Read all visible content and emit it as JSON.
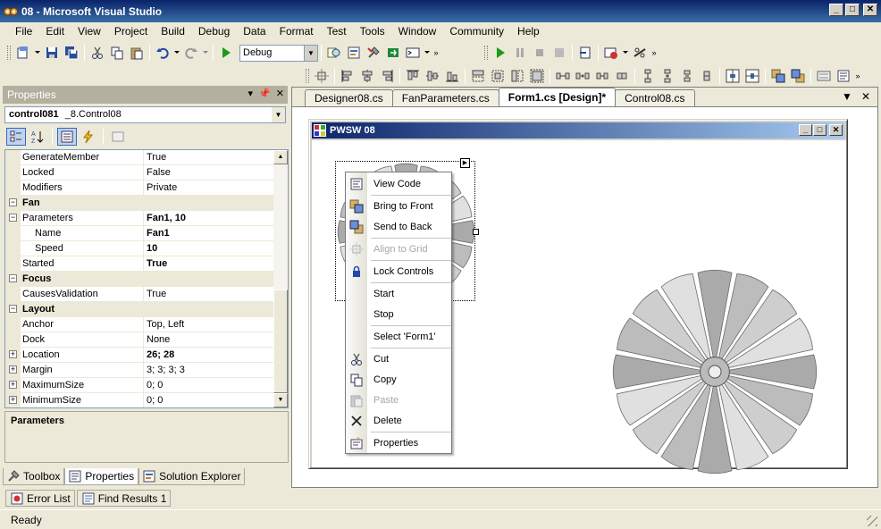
{
  "window": {
    "title": "08 - Microsoft Visual Studio"
  },
  "menu": [
    "File",
    "Edit",
    "View",
    "Project",
    "Build",
    "Debug",
    "Data",
    "Format",
    "Test",
    "Tools",
    "Window",
    "Community",
    "Help"
  ],
  "toolbar": {
    "config": "Debug"
  },
  "properties": {
    "header": "Properties",
    "object_name": "control081",
    "object_type": "_8.Control08",
    "rows": [
      {
        "name": "GenerateMember",
        "value": "True"
      },
      {
        "name": "Locked",
        "value": "False"
      },
      {
        "name": "Modifiers",
        "value": "Private"
      },
      {
        "name": "Fan",
        "value": ""
      },
      {
        "name": "Parameters",
        "value": "Fan1, 10"
      },
      {
        "name": "Name",
        "value": "Fan1"
      },
      {
        "name": "Speed",
        "value": "10"
      },
      {
        "name": "Started",
        "value": "True"
      },
      {
        "name": "Focus",
        "value": ""
      },
      {
        "name": "CausesValidation",
        "value": "True"
      },
      {
        "name": "Layout",
        "value": ""
      },
      {
        "name": "Anchor",
        "value": "Top, Left"
      },
      {
        "name": "Dock",
        "value": "None"
      },
      {
        "name": "Location",
        "value": "26; 28"
      },
      {
        "name": "Margin",
        "value": "3; 3; 3; 3"
      },
      {
        "name": "MaximumSize",
        "value": "0; 0"
      },
      {
        "name": "MinimumSize",
        "value": "0; 0"
      }
    ],
    "description_title": "Parameters"
  },
  "left_tabs": [
    "Toolbox",
    "Properties",
    "Solution Explorer"
  ],
  "bottom_tabs": [
    "Error List",
    "Find Results 1"
  ],
  "status": "Ready",
  "doc_tabs": [
    "Designer08.cs",
    "FanParameters.cs",
    "Form1.cs [Design]*",
    "Control08.cs"
  ],
  "form": {
    "title": "PWSW 08"
  },
  "context_menu": [
    {
      "label": "View Code",
      "enabled": true
    },
    {
      "label": "Bring to Front",
      "enabled": true
    },
    {
      "label": "Send to Back",
      "enabled": true
    },
    {
      "label": "Align to Grid",
      "enabled": false
    },
    {
      "label": "Lock Controls",
      "enabled": true
    },
    {
      "label": "Start",
      "enabled": true
    },
    {
      "label": "Stop",
      "enabled": true
    },
    {
      "label": "Select 'Form1'",
      "enabled": true
    },
    {
      "label": "Cut",
      "enabled": true
    },
    {
      "label": "Copy",
      "enabled": true
    },
    {
      "label": "Paste",
      "enabled": false
    },
    {
      "label": "Delete",
      "enabled": true
    },
    {
      "label": "Properties",
      "enabled": true
    }
  ]
}
